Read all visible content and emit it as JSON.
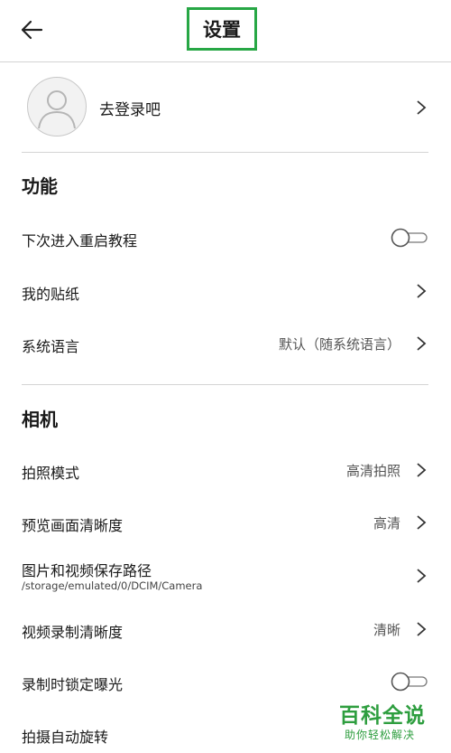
{
  "header": {
    "title": "设置"
  },
  "profile": {
    "login_text": "去登录吧"
  },
  "sections": {
    "features": {
      "title": "功能",
      "restart_tutorial": "下次进入重启教程",
      "my_stickers": "我的贴纸",
      "system_language": "系统语言",
      "system_language_value": "默认（随系统语言）"
    },
    "camera": {
      "title": "相机",
      "photo_mode": "拍照模式",
      "photo_mode_value": "高清拍照",
      "preview_clarity": "预览画面清晰度",
      "preview_clarity_value": "高清",
      "save_path": "图片和视频保存路径",
      "save_path_value": "/storage/emulated/0/DCIM/Camera",
      "video_clarity": "视频录制清晰度",
      "video_clarity_value": "清晰",
      "lock_exposure": "录制时锁定曝光",
      "auto_rotate": "拍摄自动旋转"
    }
  },
  "toggles": {
    "restart_tutorial_on": false,
    "lock_exposure_on": false
  },
  "watermark": {
    "title": "百科全说",
    "subtitle": "助你轻松解决"
  },
  "colors": {
    "accent_green": "#27a745",
    "watermark_green": "#2e9e3f",
    "divider": "#d4d4d4"
  }
}
